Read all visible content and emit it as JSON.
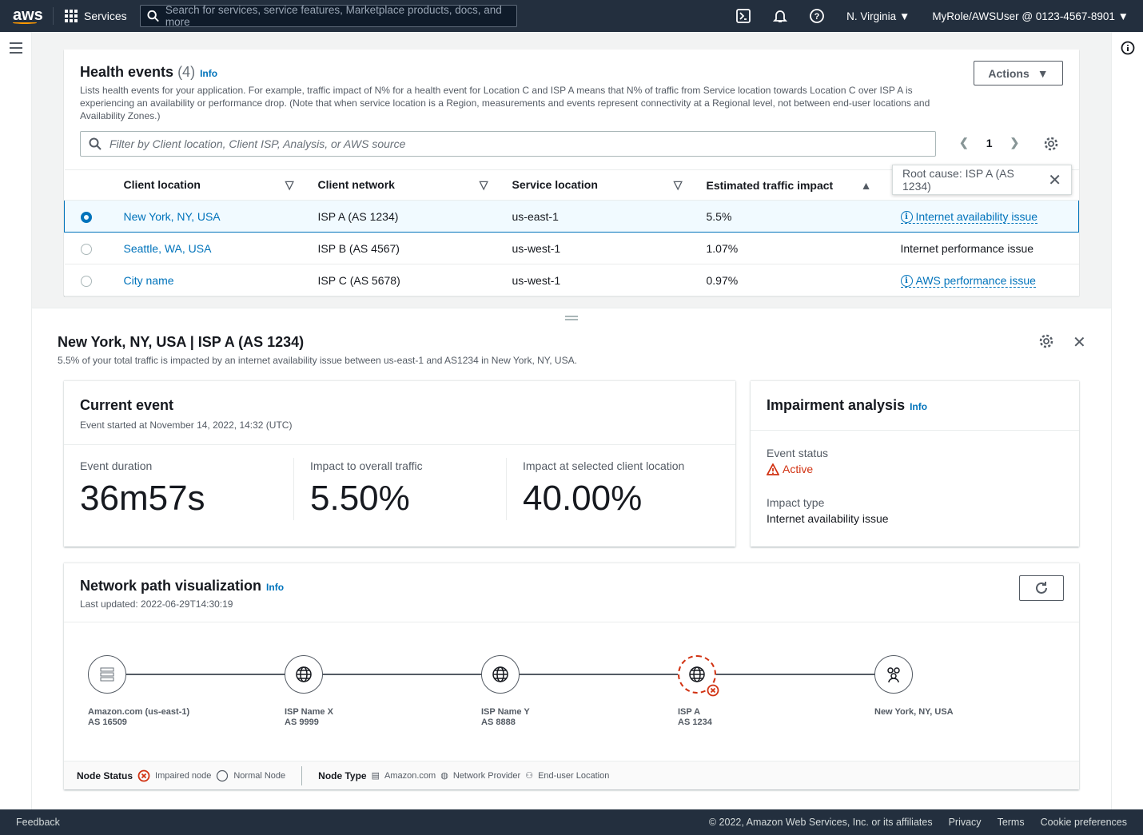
{
  "topnav": {
    "logo": "aws",
    "services": "Services",
    "search_placeholder": "Search for services, service features, Marketplace products, docs, and more",
    "region": "N. Virginia",
    "account": "MyRole/AWSUser @ 0123-4567-8901"
  },
  "health": {
    "title": "Health events",
    "count": "(4)",
    "info": "Info",
    "description": "Lists health events for your application. For example, traffic impact of N% for a health event for Location C and ISP A means that N% of traffic from Service location towards Location C over ISP A is experiencing an availability or performance drop. (Note that when service location is a Region, measurements and events represent connectivity at a Regional level, not between end-user locations and Availability Zones.)",
    "actions": "Actions",
    "filter_placeholder": "Filter by Client location, Client ISP, Analysis, or AWS source",
    "page": "1",
    "columns": [
      "Client location",
      "Client network",
      "Service location",
      "Estimated traffic impact"
    ],
    "rows": [
      {
        "location": "New York, NY, USA",
        "network": "ISP A (AS 1234)",
        "service": "us-east-1",
        "impact": "5.5%",
        "analysis": "Internet availability issue",
        "selected": true
      },
      {
        "location": "Seattle, WA, USA",
        "network": "ISP B (AS 4567)",
        "service": "us-west-1",
        "impact": "1.07%",
        "analysis": "Internet performance issue",
        "selected": false
      },
      {
        "location": "City name",
        "network": "ISP C (AS 5678)",
        "service": "us-west-1",
        "impact": "0.97%",
        "analysis": "AWS performance issue",
        "selected": false
      }
    ],
    "tooltip": "Root cause: ISP A (AS 1234)"
  },
  "detail": {
    "title": "New York, NY, USA | ISP A (AS 1234)",
    "subtitle": "5.5% of your total traffic is impacted by an internet availability issue between us-east-1 and AS1234 in New York, NY, USA.",
    "current": {
      "title": "Current event",
      "started": "Event started at November 14, 2022, 14:32 (UTC)",
      "metrics": [
        {
          "label": "Event duration",
          "value": "36m57s"
        },
        {
          "label": "Impact to overall traffic",
          "value": "5.50%"
        },
        {
          "label": "Impact at selected client location",
          "value": "40.00%"
        }
      ]
    },
    "impairment": {
      "title": "Impairment analysis",
      "info": "Info",
      "status_label": "Event status",
      "status": "Active",
      "type_label": "Impact type",
      "type": "Internet availability issue",
      "status_color": "#d13212"
    },
    "network": {
      "title": "Network path visualization",
      "info": "Info",
      "updated": "Last updated: 2022-06-29T14:30:19",
      "nodes": [
        {
          "name": "Amazon.com (us-east-1)",
          "as": "AS 16509",
          "type": "amazon",
          "impaired": false
        },
        {
          "name": "ISP Name X",
          "as": "AS 9999",
          "type": "network",
          "impaired": false
        },
        {
          "name": "ISP Name Y",
          "as": "AS 8888",
          "type": "network",
          "impaired": false
        },
        {
          "name": "ISP A",
          "as": "AS 1234",
          "type": "network",
          "impaired": true
        },
        {
          "name": "New York, NY, USA",
          "as": "",
          "type": "enduser",
          "impaired": false
        }
      ],
      "legend": {
        "status_label": "Node Status",
        "impaired": "Impaired node",
        "normal": "Normal Node",
        "type_label": "Node Type",
        "amazon": "Amazon.com",
        "provider": "Network Provider",
        "enduser": "End-user Location"
      }
    }
  },
  "footer": {
    "feedback": "Feedback",
    "copyright": "© 2022, Amazon Web Services, Inc. or its affiliates",
    "privacy": "Privacy",
    "terms": "Terms",
    "cookies": "Cookie preferences"
  }
}
